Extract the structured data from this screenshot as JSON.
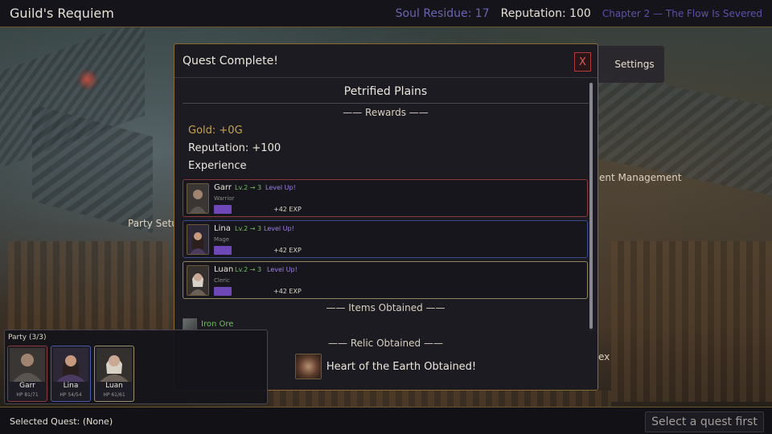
{
  "topbar": {
    "title": "Guild's Requiem",
    "soul_residue": "Soul Residue: 17",
    "reputation": "Reputation: 100",
    "chapter": "Chapter 2 — The Flow Is Severed"
  },
  "background_menu": {
    "settings": "Settings",
    "party_setup": "Party Setu",
    "management": "ent Management",
    "partial_label": "ex"
  },
  "modal": {
    "title": "Quest Complete!",
    "close_label": "X",
    "location": "Petrified Plains",
    "rewards_header": "—— Rewards ——",
    "gold": "Gold: +0G",
    "reputation": "Reputation: +100",
    "experience_label": "Experience",
    "members": [
      {
        "name": "Garr",
        "level": "Lv.2 → 3",
        "level_up": "Level Up!",
        "class": "Warrior",
        "exp": "+42 EXP"
      },
      {
        "name": "Lina",
        "level": "Lv.2 → 3",
        "level_up": "Level Up!",
        "class": "Mage",
        "exp": "+42 EXP"
      },
      {
        "name": "Luan",
        "level": "Lv.2 → 3",
        "level_up": "Level Up!",
        "class": "Cleric",
        "exp": "+42 EXP"
      }
    ],
    "items_header": "—— Items Obtained ——",
    "items": [
      {
        "name": "Iron Ore",
        "icon": "ore-icon"
      }
    ],
    "relic_header": "—— Relic Obtained ——",
    "relic": {
      "name": "Heart of the Earth Obtained!",
      "icon": "relic-heart-icon"
    }
  },
  "party": {
    "title": "Party (3/3)",
    "members": [
      {
        "name": "Garr",
        "hp": "HP 81/71"
      },
      {
        "name": "Lina",
        "hp": "HP 54/54"
      },
      {
        "name": "Luan",
        "hp": "HP 61/61"
      }
    ]
  },
  "bottombar": {
    "selected_quest": "Selected Quest: (None)",
    "select_button": "Select a quest first"
  },
  "colors": {
    "accent_gold": "#c9a24a",
    "level_green": "#6fc15b",
    "level_up_purple": "#9d80e0",
    "exp_bar": "#6f48b8",
    "close_red": "#e05a5a"
  }
}
